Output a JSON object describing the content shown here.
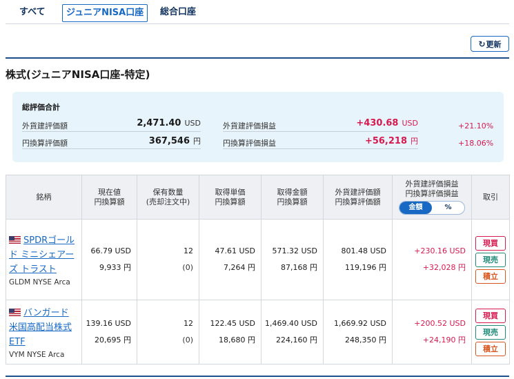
{
  "tabs": {
    "all": "すべて",
    "junior_nisa": "ジュニアNISA口座",
    "sogo": "総合口座"
  },
  "refresh_label": "更新",
  "section_title": "株式(ジュニアNISA口座-特定)",
  "summary": {
    "heading": "総評価合計",
    "foreign_value_label": "外貨建評価額",
    "foreign_value": "2,471.40",
    "foreign_value_unit": "USD",
    "yen_value_label": "円換算評価額",
    "yen_value": "367,546",
    "yen_value_unit": "円",
    "foreign_pl_label": "外貨建評価損益",
    "foreign_pl": "+430.68",
    "foreign_pl_unit": "USD",
    "foreign_pl_pct": "+21.10%",
    "yen_pl_label": "円換算評価損益",
    "yen_pl": "+56,218",
    "yen_pl_unit": "円",
    "yen_pl_pct": "+18.06%"
  },
  "table": {
    "headers": {
      "name": "銘柄",
      "price_1": "現在値",
      "price_2": "円換算額",
      "qty_1": "保有数量",
      "qty_2": "(売却注文中)",
      "unit_1": "取得単価",
      "unit_2": "円換算額",
      "cost_1": "取得金額",
      "cost_2": "円換算額",
      "val_1": "外貨建評価額",
      "val_2": "円換算評価額",
      "pl_1": "外貨建評価損益",
      "pl_2": "円換算評価損益",
      "toggle_amount": "金額",
      "toggle_pct": "%",
      "trade": "取引"
    },
    "rows": [
      {
        "name": "SPDRゴールド ミニシェアーズ トラスト",
        "ticker": "GLDM NYSE Arca",
        "price": "66.79 USD",
        "price_yen": "9,933 円",
        "qty": "12",
        "qty_pending": "(0)",
        "unit_cost": "47.61 USD",
        "unit_cost_yen": "7,264 円",
        "cost": "571.32 USD",
        "cost_yen": "87,168 円",
        "value": "801.48 USD",
        "value_yen": "119,196 円",
        "pl": "+230.16 USD",
        "pl_yen": "+32,028 円",
        "buy": "現買",
        "sell": "現売",
        "accum": "積立"
      },
      {
        "name": "バンガード 米国高配当株式ETF",
        "ticker": "VYM NYSE Arca",
        "price": "139.16 USD",
        "price_yen": "20,695 円",
        "qty": "12",
        "qty_pending": "(0)",
        "unit_cost": "122.45 USD",
        "unit_cost_yen": "18,680 円",
        "cost": "1,469.40 USD",
        "cost_yen": "224,160 円",
        "value": "1,669.92 USD",
        "value_yen": "248,350 円",
        "pl": "+200.52 USD",
        "pl_yen": "+24,190 円",
        "buy": "現買",
        "sell": "現売",
        "accum": "積立"
      }
    ]
  },
  "colors": {
    "accent": "#1769c4",
    "positive": "#d6194f",
    "sell": "#1f8a78",
    "accumulate": "#d9551e",
    "summary_bg": "#e8f4fb"
  }
}
